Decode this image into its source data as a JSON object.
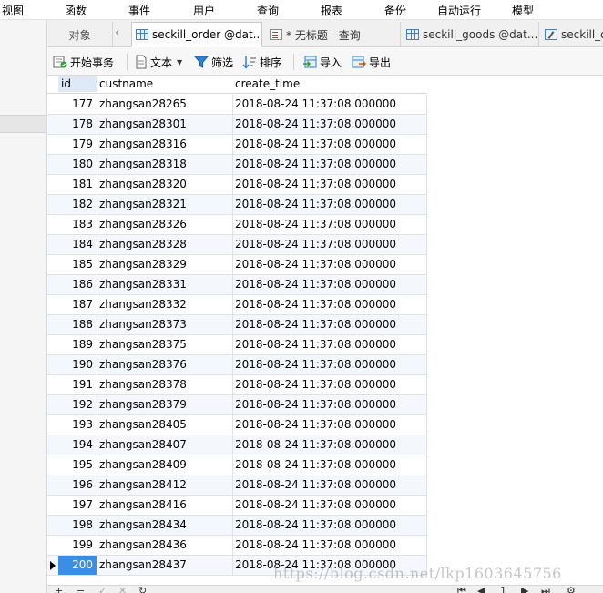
{
  "menu": [
    "视图",
    "函数",
    "事件",
    "用户",
    "查询",
    "报表",
    "备份",
    "自动运行",
    "模型"
  ],
  "tabs": {
    "objects": "对象",
    "items": [
      {
        "label": "seckill_order @dat...",
        "icon": "table-grid-icon",
        "active": true
      },
      {
        "label": "* 无标题 - 查询",
        "icon": "query-icon",
        "active": false
      },
      {
        "label": "seckill_goods @dat...",
        "icon": "table-grid-icon",
        "active": false
      },
      {
        "label": "seckill_o",
        "icon": "design-table-icon",
        "active": false
      }
    ]
  },
  "toolbar": {
    "begin_transaction": "开始事务",
    "text": "文本",
    "filter": "筛选",
    "sort": "排序",
    "import": "导入",
    "export": "导出"
  },
  "columns": {
    "id": "id",
    "custname": "custname",
    "create_time": "create_time"
  },
  "rows": [
    {
      "id": "177",
      "custname": "zhangsan28265",
      "create_time": "2018-08-24 11:37:08.000000"
    },
    {
      "id": "178",
      "custname": "zhangsan28301",
      "create_time": "2018-08-24 11:37:08.000000"
    },
    {
      "id": "179",
      "custname": "zhangsan28316",
      "create_time": "2018-08-24 11:37:08.000000"
    },
    {
      "id": "180",
      "custname": "zhangsan28318",
      "create_time": "2018-08-24 11:37:08.000000"
    },
    {
      "id": "181",
      "custname": "zhangsan28320",
      "create_time": "2018-08-24 11:37:08.000000"
    },
    {
      "id": "182",
      "custname": "zhangsan28321",
      "create_time": "2018-08-24 11:37:08.000000"
    },
    {
      "id": "183",
      "custname": "zhangsan28326",
      "create_time": "2018-08-24 11:37:08.000000"
    },
    {
      "id": "184",
      "custname": "zhangsan28328",
      "create_time": "2018-08-24 11:37:08.000000"
    },
    {
      "id": "185",
      "custname": "zhangsan28329",
      "create_time": "2018-08-24 11:37:08.000000"
    },
    {
      "id": "186",
      "custname": "zhangsan28331",
      "create_time": "2018-08-24 11:37:08.000000"
    },
    {
      "id": "187",
      "custname": "zhangsan28332",
      "create_time": "2018-08-24 11:37:08.000000"
    },
    {
      "id": "188",
      "custname": "zhangsan28373",
      "create_time": "2018-08-24 11:37:08.000000"
    },
    {
      "id": "189",
      "custname": "zhangsan28375",
      "create_time": "2018-08-24 11:37:08.000000"
    },
    {
      "id": "190",
      "custname": "zhangsan28376",
      "create_time": "2018-08-24 11:37:08.000000"
    },
    {
      "id": "191",
      "custname": "zhangsan28378",
      "create_time": "2018-08-24 11:37:08.000000"
    },
    {
      "id": "192",
      "custname": "zhangsan28379",
      "create_time": "2018-08-24 11:37:08.000000"
    },
    {
      "id": "193",
      "custname": "zhangsan28405",
      "create_time": "2018-08-24 11:37:08.000000"
    },
    {
      "id": "194",
      "custname": "zhangsan28407",
      "create_time": "2018-08-24 11:37:08.000000"
    },
    {
      "id": "195",
      "custname": "zhangsan28409",
      "create_time": "2018-08-24 11:37:08.000000"
    },
    {
      "id": "196",
      "custname": "zhangsan28412",
      "create_time": "2018-08-24 11:37:08.000000"
    },
    {
      "id": "197",
      "custname": "zhangsan28416",
      "create_time": "2018-08-24 11:37:08.000000"
    },
    {
      "id": "198",
      "custname": "zhangsan28434",
      "create_time": "2018-08-24 11:37:08.000000"
    },
    {
      "id": "199",
      "custname": "zhangsan28436",
      "create_time": "2018-08-24 11:37:08.000000"
    },
    {
      "id": "200",
      "custname": "zhangsan28437",
      "create_time": "2018-08-24 11:37:08.000000"
    }
  ],
  "current_row_id": "200",
  "bottom": {
    "page": "1"
  },
  "watermark": "https://blog.csdn.net/lkp1603645756",
  "colors": {
    "accent": "#3a8ee6",
    "alt_row": "#f4f8fc",
    "header_highlight": "#dfe9f5"
  }
}
